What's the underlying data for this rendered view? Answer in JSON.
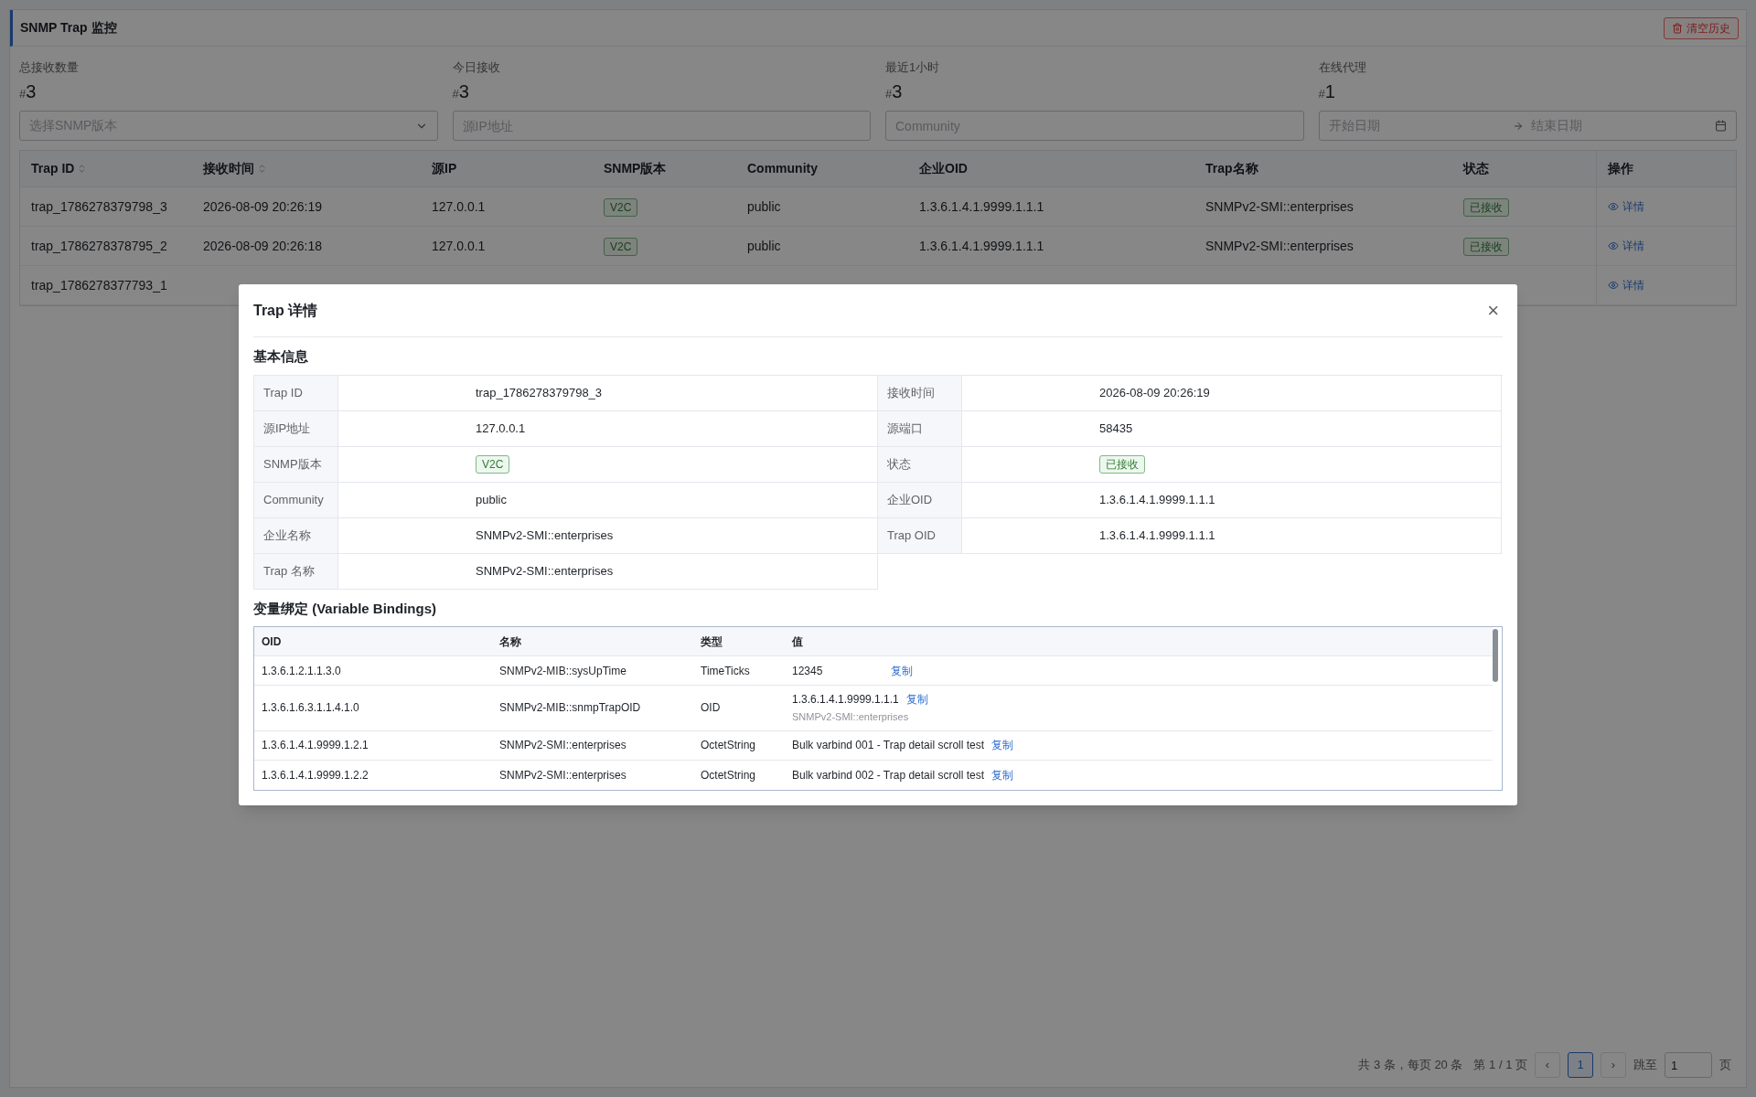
{
  "header": {
    "title": "SNMP Trap 监控",
    "clear_button": "清空历史"
  },
  "stats": [
    {
      "label": "总接收数量",
      "prefix": "#",
      "value": "3"
    },
    {
      "label": "今日接收",
      "prefix": "#",
      "value": "3"
    },
    {
      "label": "最近1小时",
      "prefix": "#",
      "value": "3"
    },
    {
      "label": "在线代理",
      "prefix": "#",
      "value": "1"
    }
  ],
  "filters": {
    "version_select": {
      "placeholder": "选择SNMP版本"
    },
    "source_ip": {
      "placeholder": "源IP地址"
    },
    "community": {
      "placeholder": "Community"
    },
    "date_range": {
      "start_placeholder": "开始日期",
      "end_placeholder": "结束日期"
    }
  },
  "table": {
    "columns": [
      {
        "label": "Trap ID",
        "sortable": true
      },
      {
        "label": "接收时间",
        "sortable": true
      },
      {
        "label": "源IP",
        "sortable": false
      },
      {
        "label": "SNMP版本",
        "sortable": false
      },
      {
        "label": "Community",
        "sortable": false
      },
      {
        "label": "企业OID",
        "sortable": false
      },
      {
        "label": "Trap名称",
        "sortable": false
      },
      {
        "label": "状态",
        "sortable": false
      },
      {
        "label": "操作",
        "sortable": false
      }
    ],
    "rows": [
      {
        "id": "trap_1786278379798_3",
        "time": "2026-08-09 20:26:19",
        "ip": "127.0.0.1",
        "version": "V2C",
        "community": "public",
        "oid": "1.3.6.1.4.1.9999.1.1.1",
        "name": "SNMPv2-SMI::enterprises",
        "status": "已接收",
        "action": "详情"
      },
      {
        "id": "trap_1786278378795_2",
        "time": "2026-08-09 20:26:18",
        "ip": "127.0.0.1",
        "version": "V2C",
        "community": "public",
        "oid": "1.3.6.1.4.1.9999.1.1.1",
        "name": "SNMPv2-SMI::enterprises",
        "status": "已接收",
        "action": "详情"
      },
      {
        "id": "trap_1786278377793_1",
        "action": "详情"
      }
    ]
  },
  "pagination": {
    "summary": "共 3 条，每页 20 条",
    "page_info": "第 1 / 1 页",
    "prev": "‹",
    "pages": [
      {
        "label": "1",
        "selected": true
      }
    ],
    "next": "›",
    "jump_label": "跳至",
    "jump_value": "1",
    "jump_suffix": "页"
  },
  "dialog": {
    "title": "Trap 详情",
    "close": "×",
    "basic_title": "基本信息",
    "basic_rows": [
      [
        {
          "label": "Trap ID",
          "value": "trap_1786278379798_3",
          "kind": "text"
        },
        {
          "label": "接收时间",
          "value": "2026-08-09 20:26:19",
          "kind": "text"
        }
      ],
      [
        {
          "label": "源IP地址",
          "value": "127.0.0.1",
          "kind": "text"
        },
        {
          "label": "源端口",
          "value": "58435",
          "kind": "text"
        }
      ],
      [
        {
          "label": "SNMP版本",
          "value": "V2C",
          "kind": "tag"
        },
        {
          "label": "状态",
          "value": "已接收",
          "kind": "tag"
        }
      ],
      [
        {
          "label": "Community",
          "value": "public",
          "kind": "text"
        },
        {
          "label": "企业OID",
          "value": "1.3.6.1.4.1.9999.1.1.1",
          "kind": "text"
        }
      ],
      [
        {
          "label": "企业名称",
          "value": "SNMPv2-SMI::enterprises",
          "kind": "text"
        },
        {
          "label": "Trap OID",
          "value": "1.3.6.1.4.1.9999.1.1.1",
          "kind": "text"
        }
      ],
      [
        {
          "label": "Trap 名称",
          "value": "SNMPv2-SMI::enterprises",
          "kind": "text"
        }
      ]
    ],
    "bindings_title": "变量绑定 (Variable Bindings)",
    "bindings": {
      "columns": [
        "OID",
        "名称",
        "类型",
        "值"
      ],
      "rows": [
        {
          "oid": "1.3.6.1.2.1.1.3.0",
          "name": "SNMPv2-MIB::sysUpTime",
          "type": "TimeTicks",
          "value": "12345",
          "copy": "复制"
        },
        {
          "oid": "1.3.6.1.6.3.1.1.4.1.0",
          "name": "SNMPv2-MIB::snmpTrapOID",
          "type": "OID",
          "value": "1.3.6.1.4.1.9999.1.1.1",
          "copy": "复制",
          "note": "SNMPv2-SMI::enterprises"
        },
        {
          "oid": "1.3.6.1.4.1.9999.1.2.1",
          "name": "SNMPv2-SMI::enterprises",
          "type": "OctetString",
          "value": "Bulk varbind 001 - Trap detail scroll test",
          "copy": "复制"
        },
        {
          "oid": "1.3.6.1.4.1.9999.1.2.2",
          "name": "SNMPv2-SMI::enterprises",
          "type": "OctetString",
          "value": "Bulk varbind 002 - Trap detail scroll test",
          "copy": "复制"
        }
      ]
    }
  }
}
